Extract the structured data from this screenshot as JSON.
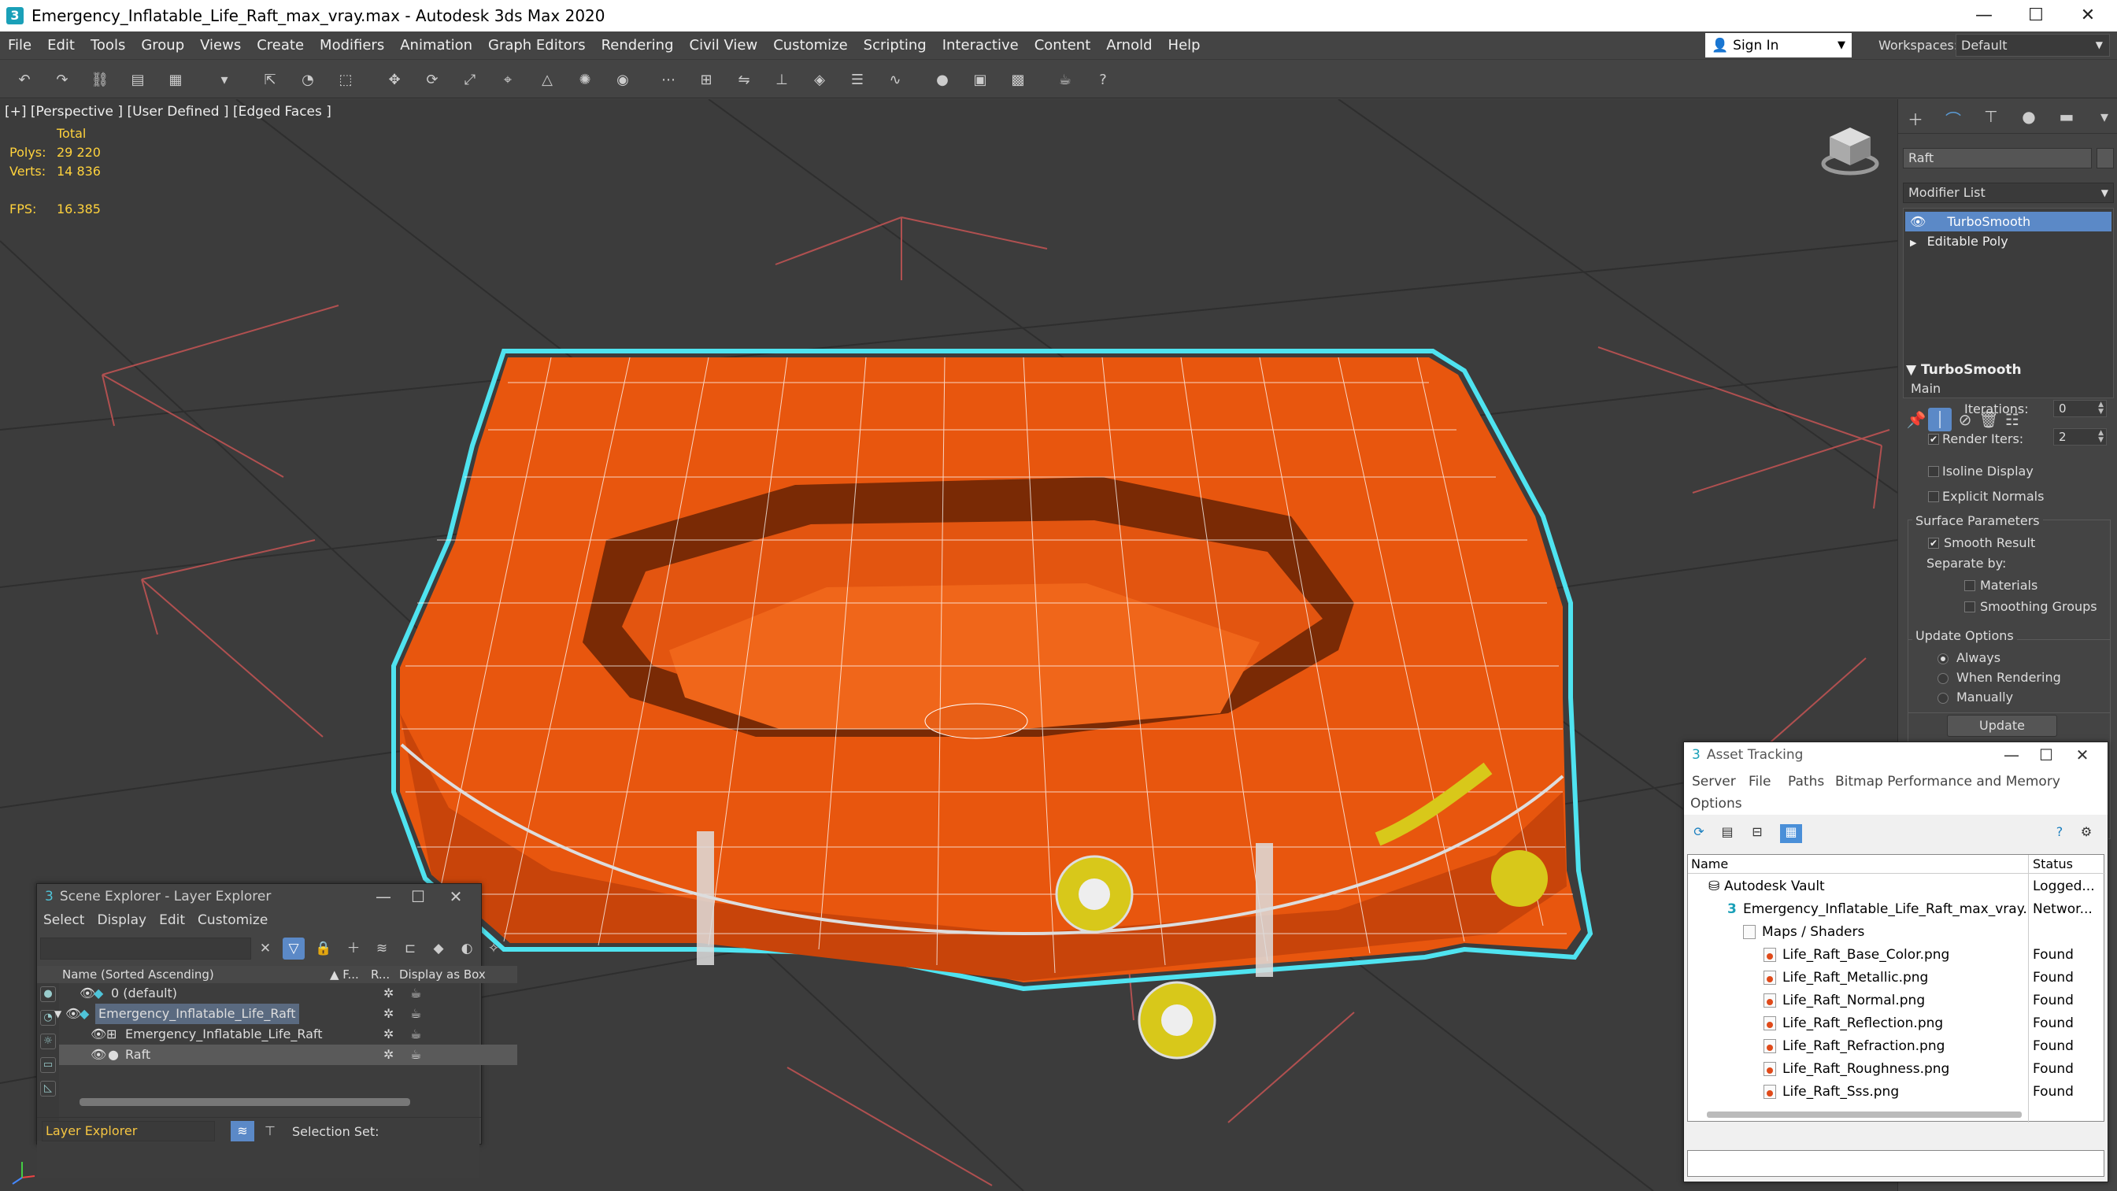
{
  "window": {
    "title": "Emergency_Inflatable_Life_Raft_max_vray.max - Autodesk 3ds Max 2020",
    "app_icon": "3",
    "minimize": "—",
    "maximize": "☐",
    "close": "✕"
  },
  "menu": [
    "File",
    "Edit",
    "Tools",
    "Group",
    "Views",
    "Create",
    "Modifiers",
    "Animation",
    "Graph Editors",
    "Rendering",
    "Civil View",
    "Customize",
    "Scripting",
    "Interactive",
    "Content",
    "Arnold",
    "Help"
  ],
  "signin": {
    "label": "Sign In"
  },
  "workspaces": {
    "label": "Workspaces:",
    "value": "Default"
  },
  "viewport": {
    "label": "[+] [Perspective ] [User Defined ] [Edged Faces ]",
    "stats_header": "Total",
    "polys_label": "Polys:",
    "polys": "29 220",
    "verts_label": "Verts:",
    "verts": "14 836",
    "fps_label": "FPS:",
    "fps": "16.385"
  },
  "command_panel": {
    "object_name": "Raft",
    "modifier_list": "Modifier List",
    "stack": [
      "TurboSmooth",
      "Editable Poly"
    ],
    "rollout": "TurboSmooth",
    "main": "Main",
    "iterations_label": "Iterations:",
    "iterations": "0",
    "render_iters_label": "Render Iters:",
    "render_iters": "2",
    "isoline": "Isoline Display",
    "explicit_normals": "Explicit Normals",
    "surface_params": "Surface Parameters",
    "smooth_result": "Smooth Result",
    "separate_by": "Separate by:",
    "materials": "Materials",
    "smoothing_groups": "Smoothing Groups",
    "update_options": "Update Options",
    "always": "Always",
    "when_rendering": "When Rendering",
    "manually": "Manually",
    "update_button": "Update"
  },
  "scene_explorer": {
    "title": "Scene Explorer - Layer Explorer",
    "menu": [
      "Select",
      "Display",
      "Edit",
      "Customize"
    ],
    "col_name": "Name (Sorted Ascending)",
    "col_f": "▲ F...",
    "col_r": "R...",
    "col_box": "Display as Box",
    "rows": [
      "0 (default)",
      "Emergency_Inflatable_Life_Raft",
      "Emergency_Inflatable_Life_Raft",
      "Raft"
    ],
    "footer_explorer": "Layer Explorer",
    "footer_selection": "Selection Set:"
  },
  "asset_tracking": {
    "title": "Asset Tracking",
    "menu": [
      "Server",
      "File",
      "Paths",
      "Bitmap Performance and Memory",
      "Options"
    ],
    "col_name": "Name",
    "col_status": "Status",
    "rows": [
      {
        "name": "Autodesk Vault",
        "status": "Logged..."
      },
      {
        "name": "Emergency_Inflatable_Life_Raft_max_vray.max",
        "status": "Networ..."
      },
      {
        "name": "Maps / Shaders",
        "status": ""
      },
      {
        "name": "Life_Raft_Base_Color.png",
        "status": "Found"
      },
      {
        "name": "Life_Raft_Metallic.png",
        "status": "Found"
      },
      {
        "name": "Life_Raft_Normal.png",
        "status": "Found"
      },
      {
        "name": "Life_Raft_Reflection.png",
        "status": "Found"
      },
      {
        "name": "Life_Raft_Refraction.png",
        "status": "Found"
      },
      {
        "name": "Life_Raft_Roughness.png",
        "status": "Found"
      },
      {
        "name": "Life_Raft_Sss.png",
        "status": "Found"
      }
    ]
  },
  "colors": {
    "raft": "#e8560e",
    "selection_outline": "#4fe3f0",
    "stats": "#ffd23c",
    "selected_item": "#5b89c7"
  }
}
